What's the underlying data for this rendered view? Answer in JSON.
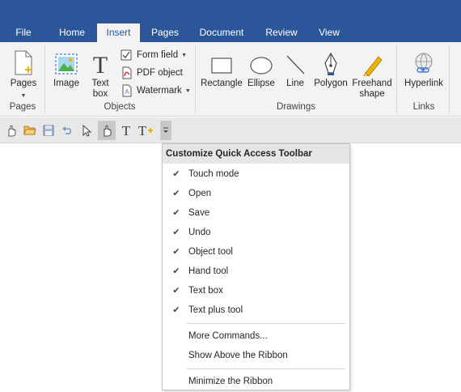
{
  "tabs": [
    "File",
    "Home",
    "Insert",
    "Pages",
    "Document",
    "Review",
    "View"
  ],
  "active_tab": "Insert",
  "ribbon": {
    "pages_button": "Pages",
    "image_button": "Image",
    "textbox_line1": "Text",
    "textbox_line2": "box",
    "form_field": "Form field",
    "pdf_object": "PDF object",
    "watermark": "Watermark",
    "rectangle": "Rectangle",
    "ellipse": "Ellipse",
    "line": "Line",
    "polygon": "Polygon",
    "freehand_line1": "Freehand",
    "freehand_line2": "shape",
    "hyperlink": "Hyperlink",
    "groups": {
      "pages": "Pages",
      "objects": "Objects",
      "drawings": "Drawings",
      "links": "Links"
    }
  },
  "qat_icons": [
    "touch-mode-icon",
    "open-icon",
    "save-icon",
    "undo-icon",
    "object-tool-icon",
    "hand-tool-icon",
    "text-box-icon",
    "text-plus-icon",
    "customize-dropdown-icon"
  ],
  "menu": {
    "title": "Customize Quick Access Toolbar",
    "checked_items": [
      "Touch mode",
      "Open",
      "Save",
      "Undo",
      "Object tool",
      "Hand tool",
      "Text box",
      "Text plus tool"
    ],
    "more_commands": "More Commands...",
    "show_above": "Show Above the Ribbon",
    "minimize": "Minimize the Ribbon"
  },
  "colors": {
    "tabbar": "#2b579a",
    "ribbon": "#f3f3f3",
    "qat": "#e8e8e8",
    "accent_yellow": "#f0b400"
  }
}
